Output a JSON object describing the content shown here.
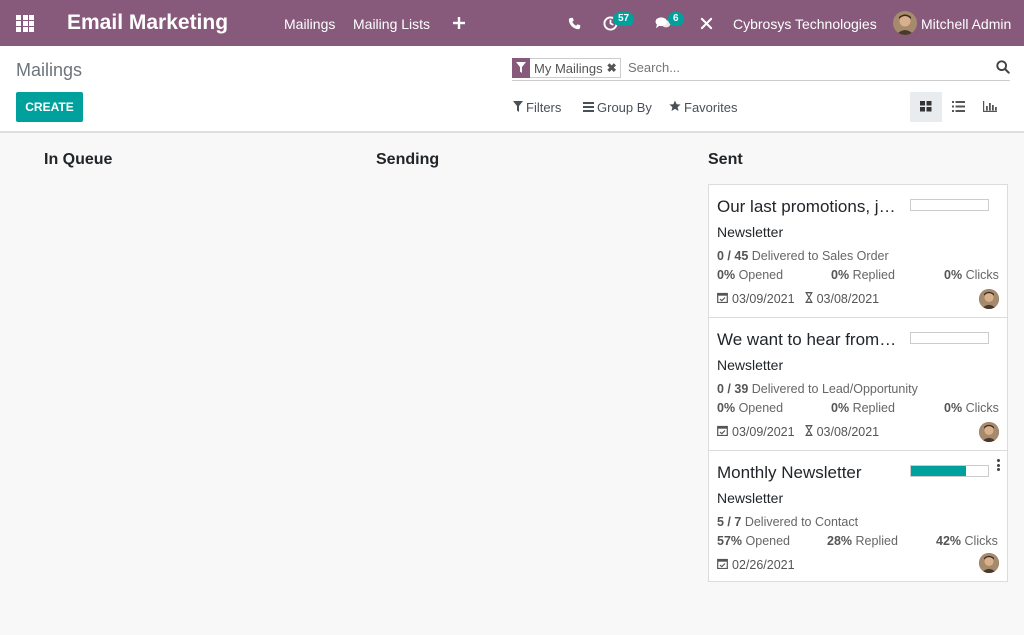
{
  "nav": {
    "app_title": "Email Marketing",
    "menu": [
      "Mailings",
      "Mailing Lists"
    ],
    "activity_count": "57",
    "message_count": "6",
    "company": "Cybrosys Technologies",
    "user": "Mitchell Admin"
  },
  "control_panel": {
    "breadcrumb": "Mailings",
    "create_label": "CREATE",
    "facet_label": "My Mailings",
    "search_placeholder": "Search...",
    "filters_label": "Filters",
    "group_by_label": "Group By",
    "favorites_label": "Favorites",
    "active_view": "kanban"
  },
  "columns": [
    "In Queue",
    "Sending",
    "Sent"
  ],
  "cards": [
    {
      "title": "Our last promotions, just for you!",
      "subtitle": "Newsletter",
      "delivered": "0 / 45",
      "delivered_to": "Delivered to Sales Order",
      "opened": "0%",
      "opened_label": "Opened",
      "replied": "0%",
      "replied_label": "Replied",
      "clicks": "0%",
      "clicks_label": "Clicks",
      "sent_date": "03/09/2021",
      "schedule_date": "03/08/2021",
      "progress": 0
    },
    {
      "title": "We want to hear from you!",
      "subtitle": "Newsletter",
      "delivered": "0 / 39",
      "delivered_to": "Delivered to Lead/Opportunity",
      "opened": "0%",
      "opened_label": "Opened",
      "replied": "0%",
      "replied_label": "Replied",
      "clicks": "0%",
      "clicks_label": "Clicks",
      "sent_date": "03/09/2021",
      "schedule_date": "03/08/2021",
      "progress": 0
    },
    {
      "title": "Monthly Newsletter",
      "subtitle": "Newsletter",
      "delivered": "5 / 7",
      "delivered_to": "Delivered to Contact",
      "opened": "57%",
      "opened_label": "Opened",
      "replied": "28%",
      "replied_label": "Replied",
      "clicks": "42%",
      "clicks_label": "Clicks",
      "sent_date": "02/26/2021",
      "progress": 0.71
    }
  ],
  "colors": {
    "brand": "#875a7b",
    "accent": "#00a09d"
  }
}
